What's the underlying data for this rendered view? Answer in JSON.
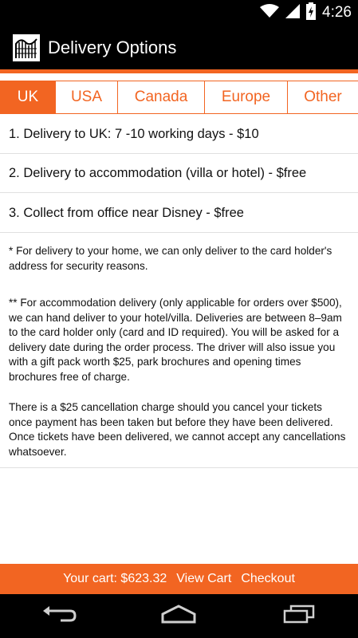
{
  "status": {
    "time": "4:26",
    "battery_level": "charging"
  },
  "app": {
    "title": "Delivery Options",
    "logo_icon": "rollercoaster-icon"
  },
  "tabs": [
    {
      "label": "UK",
      "active": true
    },
    {
      "label": "USA",
      "active": false
    },
    {
      "label": "Canada",
      "active": false
    },
    {
      "label": "Europe",
      "active": false
    },
    {
      "label": "Other",
      "active": false
    }
  ],
  "options": [
    "1. Delivery to UK: 7 -10 working days - $10",
    "2. Delivery to accommodation (villa or hotel) - $free",
    "3. Collect from office near Disney - $free"
  ],
  "notes": {
    "home": "* For delivery to your home, we can only deliver to the card holder's address for security reasons.",
    "accommodation": "** For accommodation delivery (only applicable for orders over $500), we can hand deliver to your hotel/villa. Deliveries are between 8–9am to the card holder only (card and ID required). You will be asked for a delivery date during the order process. The driver will also issue you with a gift pack worth $25, park brochures and opening times brochures free of charge.",
    "cancellation": "There is a $25 cancellation charge should you cancel your tickets once payment has been taken but before they have been delivered. Once tickets have been delivered, we cannot accept any cancellations whatsoever."
  },
  "cart": {
    "total": "Your cart: $623.32",
    "view": "View Cart",
    "checkout": "Checkout"
  },
  "colors": {
    "accent": "#f26522",
    "bar": "#000000"
  }
}
